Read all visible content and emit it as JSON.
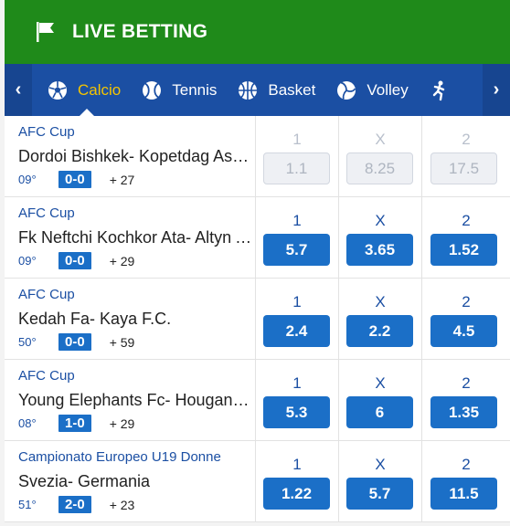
{
  "header": {
    "title": "LIVE BETTING",
    "icon": "flag-icon"
  },
  "nav": {
    "tabs": [
      {
        "label": "Calcio",
        "icon": "soccer-ball-icon",
        "active": true
      },
      {
        "label": "Tennis",
        "icon": "tennis-ball-icon"
      },
      {
        "label": "Basket",
        "icon": "basketball-icon"
      },
      {
        "label": "Volley",
        "icon": "volleyball-icon"
      },
      {
        "label": "",
        "icon": "athlete-icon"
      }
    ]
  },
  "colors": {
    "header": "#1f8a1a",
    "nav": "#1b4fa3",
    "active_tab": "#f5c400",
    "odd_button": "#1b6fc7"
  },
  "events": [
    {
      "competition": "AFC Cup",
      "teams": "Dordoi Bishkek- Kopetdag Asgabat",
      "minute": "09°",
      "score": "0-0",
      "more": "+ 27",
      "odds": [
        {
          "label": "1",
          "value": "1.1"
        },
        {
          "label": "X",
          "value": "8.25"
        },
        {
          "label": "2",
          "value": "17.5"
        }
      ],
      "disabled": true
    },
    {
      "competition": "AFC Cup",
      "teams": "Fk Neftchi Kochkor Ata- Altyn Asyr",
      "minute": "09°",
      "score": "0-0",
      "more": "+ 29",
      "odds": [
        {
          "label": "1",
          "value": "5.7"
        },
        {
          "label": "X",
          "value": "3.65"
        },
        {
          "label": "2",
          "value": "1.52"
        }
      ]
    },
    {
      "competition": "AFC Cup",
      "teams": "Kedah Fa- Kaya F.C.",
      "minute": "50°",
      "score": "0-0",
      "more": "+ 59",
      "odds": [
        {
          "label": "1",
          "value": "2.4"
        },
        {
          "label": "X",
          "value": "2.2"
        },
        {
          "label": "2",
          "value": "4.5"
        }
      ]
    },
    {
      "competition": "AFC Cup",
      "teams": "Young Elephants Fc- Hougang United",
      "minute": "08°",
      "score": "1-0",
      "more": "+ 29",
      "odds": [
        {
          "label": "1",
          "value": "5.3"
        },
        {
          "label": "X",
          "value": "6"
        },
        {
          "label": "2",
          "value": "1.35"
        }
      ]
    },
    {
      "competition": "Campionato Europeo U19 Donne",
      "teams": "Svezia- Germania",
      "minute": "51°",
      "score": "2-0",
      "more": "+ 23",
      "odds": [
        {
          "label": "1",
          "value": "1.22"
        },
        {
          "label": "X",
          "value": "5.7"
        },
        {
          "label": "2",
          "value": "11.5"
        }
      ]
    }
  ]
}
